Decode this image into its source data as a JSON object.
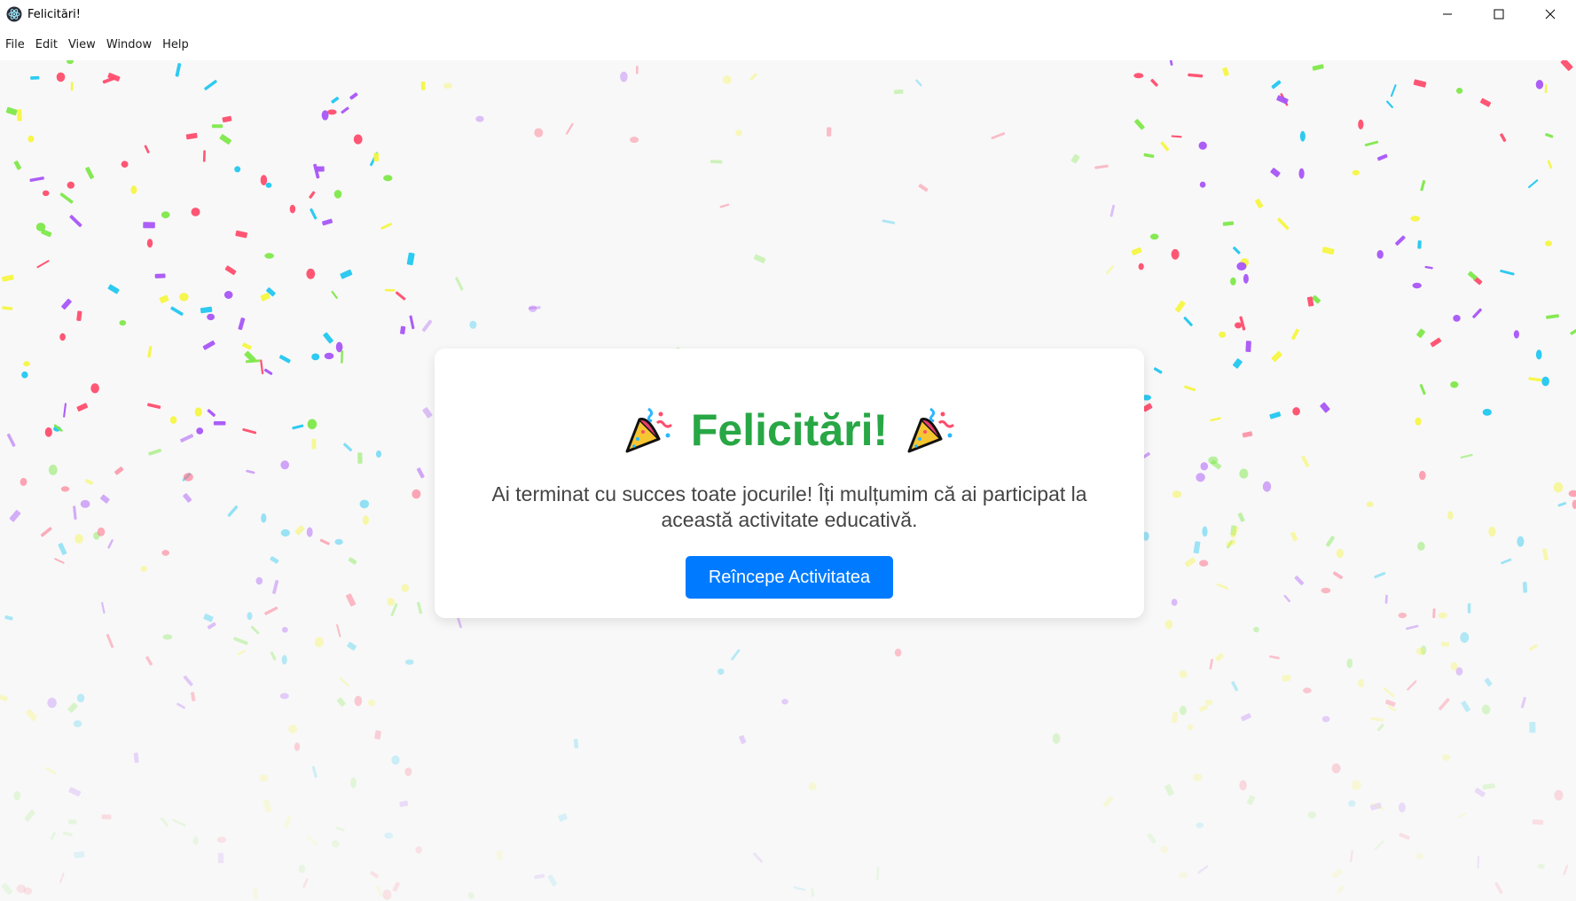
{
  "window": {
    "title": "Felicitări!",
    "controls": [
      "minimize",
      "maximize",
      "close"
    ]
  },
  "menubar": {
    "items": [
      "File",
      "Edit",
      "View",
      "Window",
      "Help"
    ]
  },
  "card": {
    "title": "Felicitări!",
    "message": "Ai terminat cu succes toate jocurile! Îți mulțumim că ai participat la această activitate educativă.",
    "button_label": "Reîncepe Activitatea",
    "title_color": "#28a745",
    "button_color": "#007bff",
    "decoration_icon": "party-popper-icon"
  },
  "confetti": {
    "colors": [
      "#ff4d6d",
      "#a855f7",
      "#22c7f0",
      "#7ee84a",
      "#f5f542"
    ]
  }
}
